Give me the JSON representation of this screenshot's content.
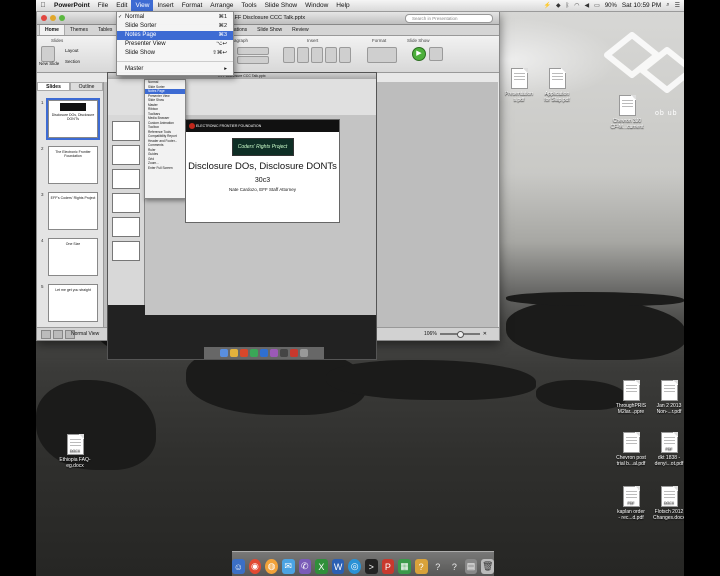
{
  "menubar": {
    "apple": "",
    "items": [
      "PowerPoint",
      "File",
      "Edit",
      "View",
      "Insert",
      "Format",
      "Arrange",
      "Tools",
      "Slide Show",
      "Window",
      "Help"
    ],
    "battery": "90%",
    "clock": "Sat 10:59 PM"
  },
  "window": {
    "title": "EFF Disclosure CCC Talk.pptx",
    "search_placeholder": "Search in Presentation",
    "tabs": [
      "Home",
      "Themes",
      "Tables",
      "Animations",
      "Slide Show",
      "Review"
    ],
    "groups": [
      "Slides",
      "Font",
      "Paragraph",
      "Insert",
      "Format",
      "Slide Show"
    ],
    "new_slide": "New Slide",
    "layout": "Layout",
    "section": "Section",
    "sidebar_tabs": [
      "Slides",
      "Outline"
    ],
    "status": "Normal View",
    "zoom": "106%"
  },
  "view_menu": [
    {
      "label": "Normal",
      "shortcut": "⌘1",
      "checked": true
    },
    {
      "label": "Slide Sorter",
      "shortcut": "⌘2"
    },
    {
      "label": "Notes Page",
      "shortcut": "⌘3",
      "highlighted": true
    },
    {
      "label": "Presenter View",
      "shortcut": "⌥↩"
    },
    {
      "label": "Slide Show",
      "shortcut": "⇧⌘↩"
    },
    {
      "label": "Master",
      "shortcut": "▸"
    }
  ],
  "slides": [
    {
      "num": "1",
      "title": "Disclosure DOs, Disclosure DON'Ts"
    },
    {
      "num": "2",
      "title": "The Electronic Frontier Foundation"
    },
    {
      "num": "3",
      "title": "EFF's Coders' Rights Project"
    },
    {
      "num": "4",
      "title": "One Size"
    },
    {
      "num": "5",
      "title": "Let me get you straight"
    }
  ],
  "slide_main": {
    "band": "ELECTRONIC FRONTIER FOUNDATION",
    "logo": "Coders' Rights Project",
    "title": "Disclosure DOs, Disclosure DONTs",
    "subtitle": "30c3",
    "speaker": "Nate Cardozo, EFF Staff Attorney"
  },
  "inner_menu": [
    "Normal",
    "Slide Sorter",
    "Notes Page",
    "Presenter View",
    "Slide Show",
    "",
    "Master",
    "",
    "Ribbon",
    "Toolbars",
    "",
    "Media Browser",
    "",
    "Custom Animation",
    "Toolbox",
    "Reference Tools",
    "Compatibility Report",
    "",
    "Header and Footer...",
    "Comments",
    "",
    "Ruler",
    "Guides",
    "Grid",
    "Zoom...",
    "Enter Full Screen"
  ],
  "watermark": "ob ub",
  "desktop_icons": [
    {
      "name": "Presentation\ns.pdf",
      "tag": ""
    },
    {
      "name": "Application\nfor Slap.pdf",
      "tag": ""
    },
    {
      "name": "Chevron 3J0\nCF-M...cument",
      "tag": ""
    },
    {
      "name": "ThroughPRIS\nM2lar...ppre",
      "tag": ""
    },
    {
      "name": "Jan 2 2013\nNon-...r.pdf",
      "tag": ""
    },
    {
      "name": "Ethiopia FAQ-\neg.docx",
      "tag": "DOCX"
    },
    {
      "name": "Chevron post\ntrial b...al.pdf",
      "tag": ""
    },
    {
      "name": "dkt 1838 -\ndenyi...ot.pdf",
      "tag": "PDF"
    },
    {
      "name": "kaplan order\n- rec...d.pdf",
      "tag": "PDF"
    },
    {
      "name": "Flotsch 2012\nChanges.docx",
      "tag": "DOCX"
    }
  ]
}
